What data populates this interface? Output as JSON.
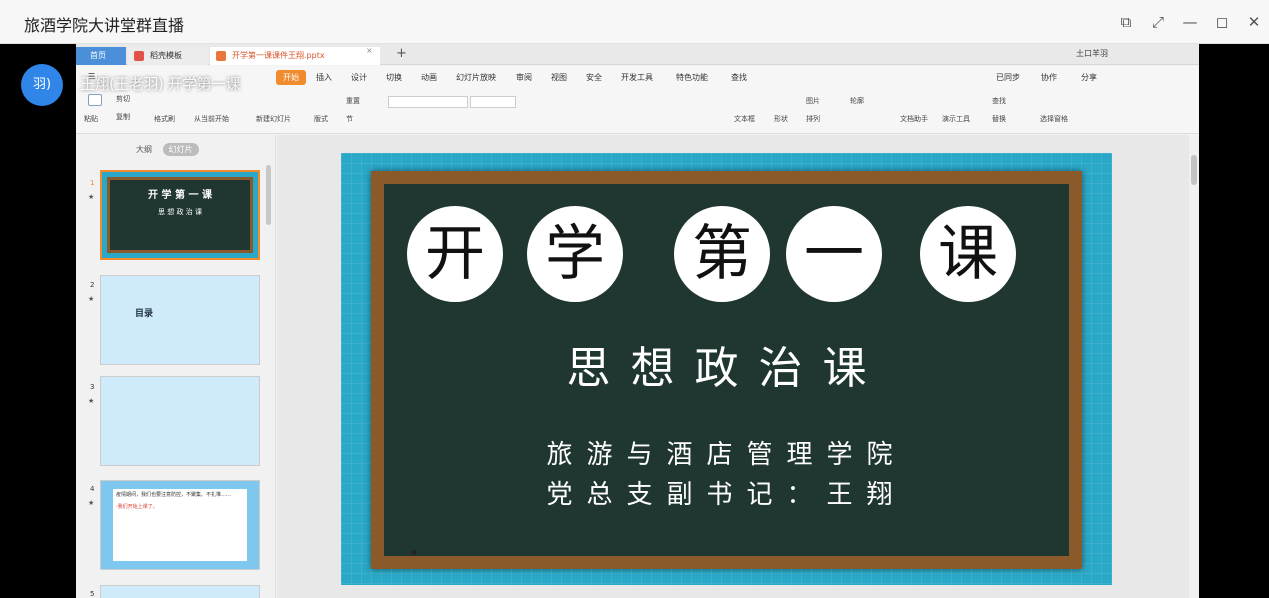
{
  "window": {
    "title": "旅酒学院大讲堂群直播"
  },
  "overlay": {
    "text": "王翔(王老羽) 开学第一课",
    "avatar": "羽)"
  },
  "wps": {
    "tabs": [
      {
        "label": "首页"
      },
      {
        "label": "稻壳模板"
      },
      {
        "label": "开学第一课课件王翔.pptx"
      }
    ],
    "user": "土口羊羽",
    "ribbon_tabs": [
      "开始",
      "插入",
      "设计",
      "切换",
      "动画",
      "幻灯片放映",
      "审阅",
      "视图",
      "安全",
      "开发工具",
      "特色功能",
      "查找"
    ],
    "ribbon_right": [
      "已同步",
      "协作",
      "分享"
    ],
    "tools": [
      "粘贴",
      "剪切",
      "复制",
      "格式刷",
      "从当前开始",
      "新建幻灯片",
      "版式",
      "节",
      "重置",
      "文本框",
      "形状",
      "排列",
      "图片",
      "轮廓",
      "文档助手",
      "演示工具",
      "查找",
      "替换",
      "选择窗格"
    ]
  },
  "panel": {
    "tab_outline": "大纲",
    "tab_slides": "幻灯片",
    "slide_numbers": [
      "1",
      "2",
      "3",
      "4",
      "5"
    ]
  },
  "thumbs": {
    "t1_title": "开 学 第 一 课",
    "t1_sub": "思 想 政 治 课",
    "t2": "目录",
    "t4": "疫情期间，我们也要注意防控，不聚集、不扎堆……",
    "t4_red": "·我们开始上课了。"
  },
  "slide": {
    "title_chars": [
      "开",
      "学",
      "第",
      "一",
      "课"
    ],
    "subtitle": "思想政治课",
    "org": "旅游与酒店管理学院",
    "person": "党总支副书记：王翔"
  }
}
